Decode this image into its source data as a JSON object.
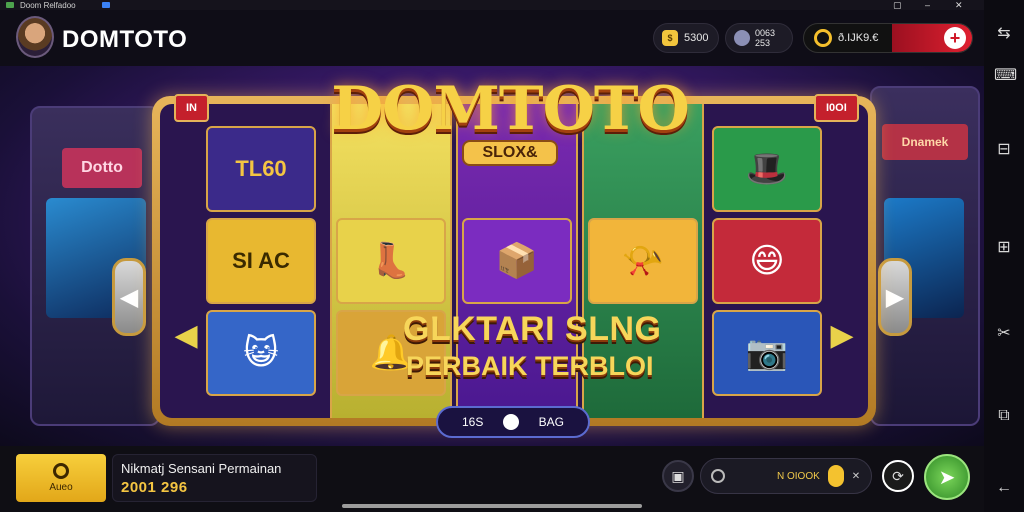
{
  "os": {
    "title": "Doom Relfadoo"
  },
  "header": {
    "brand": "DOMTOTO",
    "coins": "5300",
    "gems_line1": "0063",
    "gems_line2": "253",
    "jackpot": "ð.IJK9.€",
    "plus": "+"
  },
  "machine": {
    "logo": "DOMTOTO",
    "logo_sub": "SLOX&",
    "badge_left": "IN",
    "badge_right": "I0OI",
    "tile_text_1": "TL60",
    "tile_text_2": "SI AC",
    "headline": "GLKTARI SLNG",
    "subline": "PERBAIK TERBLOI",
    "pill_left": "16S",
    "pill_right": "BAG",
    "left_arrow": "◀",
    "right_arrow": "▶"
  },
  "bottom": {
    "bonus_label": "Aueo",
    "info_title": "Nikmatj Sensani Permainan",
    "info_value": "2001 296",
    "bet_text": "N OIOOK",
    "bet_x": "✕",
    "spin_icon": "➤"
  },
  "colors": {
    "accent_gold": "#f6d146",
    "spin_green": "#4caf3a",
    "jackpot_red": "#d01828"
  }
}
